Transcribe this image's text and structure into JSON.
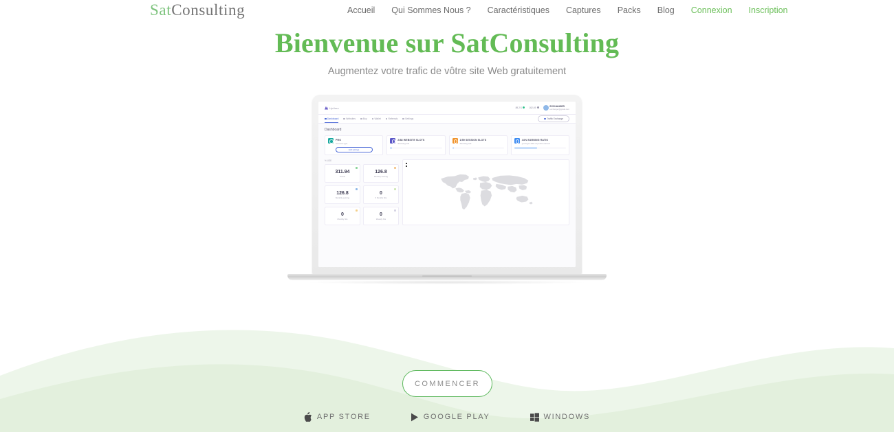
{
  "brand": {
    "part1": "Sat",
    "part2": "Consulting"
  },
  "colors": {
    "brand_green": "#63bb55",
    "logo_green": "#7dc37d",
    "nav_text": "#6b6b6b",
    "wave_light": "#eaf4e6",
    "wave_dark": "#e1eedd",
    "cta_border": "#5cb85c"
  },
  "nav": {
    "items": [
      {
        "label": "Accueil",
        "style": "default"
      },
      {
        "label": "Qui Sommes Nous ?",
        "style": "default"
      },
      {
        "label": "Caractéristiques",
        "style": "default"
      },
      {
        "label": "Captures",
        "style": "default"
      },
      {
        "label": "Packs",
        "style": "default"
      },
      {
        "label": "Blog",
        "style": "default"
      },
      {
        "label": "Connexion",
        "style": "green"
      },
      {
        "label": "Inscription",
        "style": "green"
      }
    ]
  },
  "hero": {
    "title": "Bienvenue sur SatConsulting",
    "subtitle": "Augmentez votre trafic de vôtre site Web gratuitement"
  },
  "cta": {
    "label": "COMMENCER"
  },
  "stores": [
    {
      "icon": "apple-icon",
      "label": "APP STORE"
    },
    {
      "icon": "play-triangle-icon",
      "label": "GOOGLE PLAY"
    },
    {
      "icon": "windows-icon",
      "label": "WINDOWS"
    }
  ],
  "screenshot": {
    "brand": "Uptime",
    "topbar": {
      "status_online": "89.2 $",
      "status_points": "162.49",
      "user_name": "EXCHANGER",
      "user_email": "exchanger@gmail.com"
    },
    "tabs": [
      {
        "label": "Dashboard",
        "active": true
      },
      {
        "label": "Websites",
        "active": false
      },
      {
        "label": "Buy",
        "active": false
      },
      {
        "label": "Wallet",
        "active": false
      },
      {
        "label": "Referrals",
        "active": false
      },
      {
        "label": "Settings",
        "active": false
      }
    ],
    "exchange_button": "Traffic Exchange",
    "page_title": "Dashboard",
    "cards": [
      {
        "icon_color": "teal",
        "title": "PRO",
        "subtitle": "Account type",
        "button": "Edit settings",
        "progress": null
      },
      {
        "icon_color": "purple",
        "title": "2/88 WEBSITE SLOTS",
        "subtitle": "Showing sell",
        "button": null,
        "progress": 4
      },
      {
        "icon_color": "orange",
        "title": "1/59 SESSION SLOTS",
        "subtitle": "Showing sell",
        "button": null,
        "progress": 3
      },
      {
        "icon_color": "blue",
        "title": "44% EARNING RATIO",
        "subtitle": "you'll get 44% of points earned",
        "button": null,
        "progress": 44
      }
    ],
    "metrics_label": "% USE",
    "metrics": [
      {
        "value": "311.94",
        "label": "Points",
        "dot": "#8bd49b"
      },
      {
        "value": "126.8",
        "label": "Monthly earning",
        "dot": "#f4c48b"
      },
      {
        "value": "126.8",
        "label": "Monthly earning",
        "dot": "#8fb8e8"
      },
      {
        "value": "0",
        "label": "6 Months hits",
        "dot": "#cfe6b6"
      },
      {
        "value": "0",
        "label": "Monthly hits",
        "dot": "#f4d08b"
      },
      {
        "value": "0",
        "label": "Weekly hits",
        "dot": "#d6d4e4"
      }
    ],
    "map": {
      "zoom_in": "+",
      "zoom_out": "−"
    }
  }
}
